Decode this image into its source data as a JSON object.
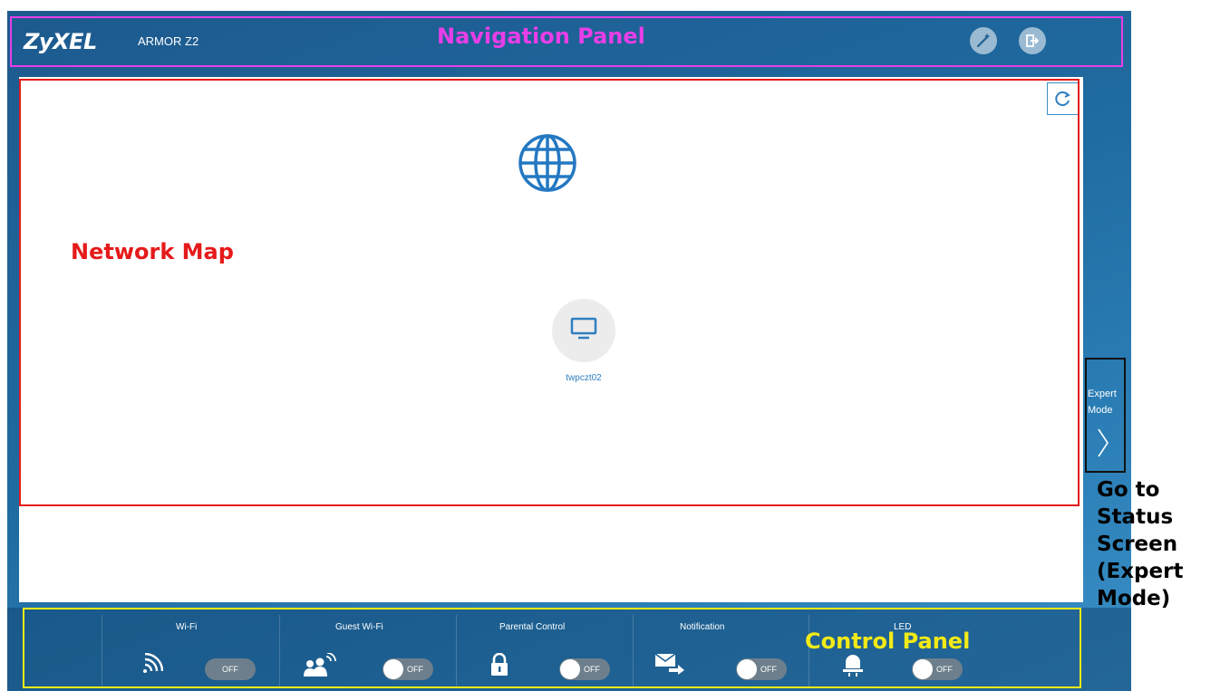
{
  "header": {
    "brand": "ZyXEL",
    "model": "ARMOR Z2"
  },
  "toolbar": {
    "wizard_icon": "magic-wand-icon",
    "logout_icon": "logout-icon"
  },
  "network_map": {
    "refresh_icon": "refresh-icon",
    "internet_icon": "globe-icon",
    "device": {
      "icon": "monitor-icon",
      "name": "twpczt02"
    }
  },
  "side": {
    "expert_mode_line1": "Expert",
    "expert_mode_line2": "Mode"
  },
  "control_panel": {
    "items": [
      {
        "label": "Wi-Fi",
        "icon": "wifi-icon",
        "state": "OFF"
      },
      {
        "label": "Guest Wi-Fi",
        "icon": "guest-wifi-icon",
        "state": "OFF"
      },
      {
        "label": "Parental Control",
        "icon": "lock-icon",
        "state": "OFF"
      },
      {
        "label": "Notification",
        "icon": "mail-forward-icon",
        "state": "OFF"
      },
      {
        "label": "LED",
        "icon": "led-lamp-icon",
        "state": "OFF"
      }
    ]
  },
  "annotations": {
    "navigation_panel": "Navigation Panel",
    "network_map": "Network Map",
    "control_panel": "Control Panel",
    "expert_mode": "Go to Status Screen (Expert Mode)"
  },
  "colors": {
    "nav_annotation": "#e83ee8",
    "map_annotation": "#e51a1a",
    "control_annotation": "#f2ea17",
    "device_label": "#2f7fc0",
    "app_bg": "#1f6aa0"
  }
}
